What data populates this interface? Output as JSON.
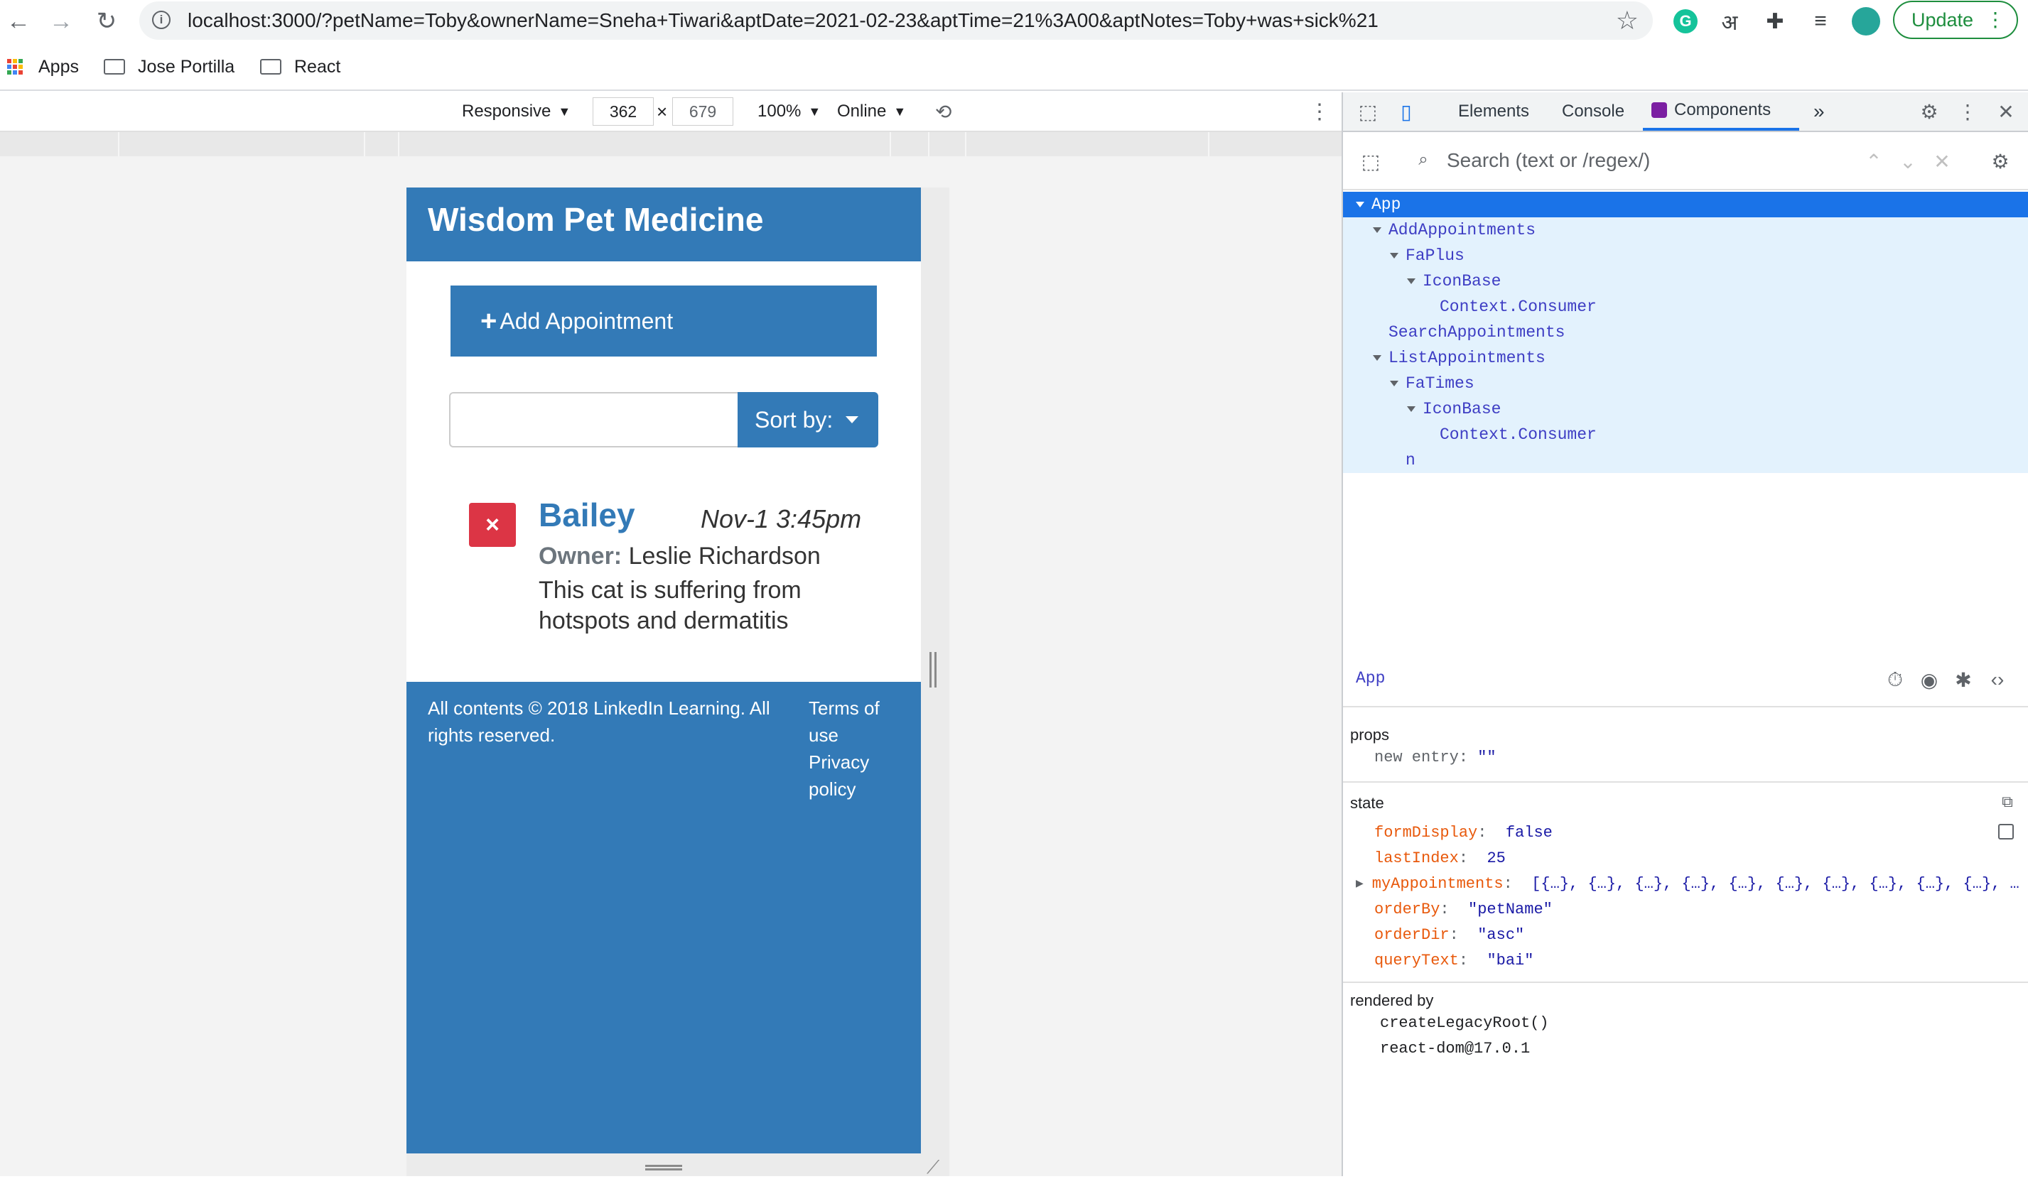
{
  "browser": {
    "url": "localhost:3000/?petName=Toby&ownerName=Sneha+Tiwari&aptDate=2021-02-23&aptTime=21%3A00&aptNotes=Toby+was+sick%21",
    "update_label": "Update",
    "bookmarks": [
      {
        "label": "Apps",
        "icon": "apps-grid-icon"
      },
      {
        "label": "Jose Portilla",
        "icon": "folder-icon"
      },
      {
        "label": "React",
        "icon": "folder-icon"
      }
    ]
  },
  "device_toolbar": {
    "device": "Responsive",
    "width": "362",
    "height": "679",
    "zoom": "100%",
    "network": "Online"
  },
  "app": {
    "title": "Wisdom Pet Medicine",
    "add_appointment": "Add Appointment",
    "search_value": "",
    "sort_label": "Sort by:",
    "appointment": {
      "pet_name": "Bailey",
      "date": "Nov-1 3:45pm",
      "owner_label": "Owner:",
      "owner_name": "Leslie Richardson",
      "notes": "This cat is suffering from hotspots and dermatitis"
    },
    "footer": {
      "copyright": "All contents © 2018 LinkedIn Learning. All rights reserved.",
      "terms": "Terms of use",
      "privacy": "Privacy policy"
    }
  },
  "devtools": {
    "tabs": [
      "Elements",
      "Console",
      "Components"
    ],
    "active_tab": "Components",
    "search_placeholder": "Search (text or /regex/)",
    "tree": [
      {
        "label": "App",
        "depth": 0,
        "expanded": true,
        "selected": true
      },
      {
        "label": "AddAppointments",
        "depth": 1,
        "expanded": true
      },
      {
        "label": "FaPlus",
        "depth": 2,
        "expanded": true
      },
      {
        "label": "IconBase",
        "depth": 3,
        "expanded": true
      },
      {
        "label": "Context.Consumer",
        "depth": 4,
        "expanded": false
      },
      {
        "label": "SearchAppointments",
        "depth": 1,
        "expanded": false
      },
      {
        "label": "ListAppointments",
        "depth": 1,
        "expanded": true
      },
      {
        "label": "FaTimes",
        "depth": 2,
        "expanded": true
      },
      {
        "label": "IconBase",
        "depth": 3,
        "expanded": true
      },
      {
        "label": "Context.Consumer",
        "depth": 4,
        "expanded": false
      },
      {
        "label": "n",
        "depth": 2,
        "expanded": false
      }
    ],
    "inspected": "App",
    "props_title": "props",
    "props": [
      {
        "key": "new entry",
        "value": "\"\""
      }
    ],
    "state_title": "state",
    "state": [
      {
        "key": "formDisplay",
        "value": "false",
        "type": "bool"
      },
      {
        "key": "lastIndex",
        "value": "25",
        "type": "num"
      },
      {
        "key": "myAppointments",
        "value": "[{…}, {…}, {…}, {…}, {…}, {…}, {…}, {…}, {…}, {…}, …",
        "type": "arr"
      },
      {
        "key": "orderBy",
        "value": "\"petName\"",
        "type": "str"
      },
      {
        "key": "orderDir",
        "value": "\"asc\"",
        "type": "str"
      },
      {
        "key": "queryText",
        "value": "\"bai\"",
        "type": "str"
      }
    ],
    "rendered_by_title": "rendered by",
    "rendered_by": [
      "createLegacyRoot()",
      "react-dom@17.0.1"
    ]
  },
  "colors": {
    "brand_blue": "#337ab7",
    "delete_red": "#dc3545",
    "devtools_selected": "#1a73e8"
  }
}
